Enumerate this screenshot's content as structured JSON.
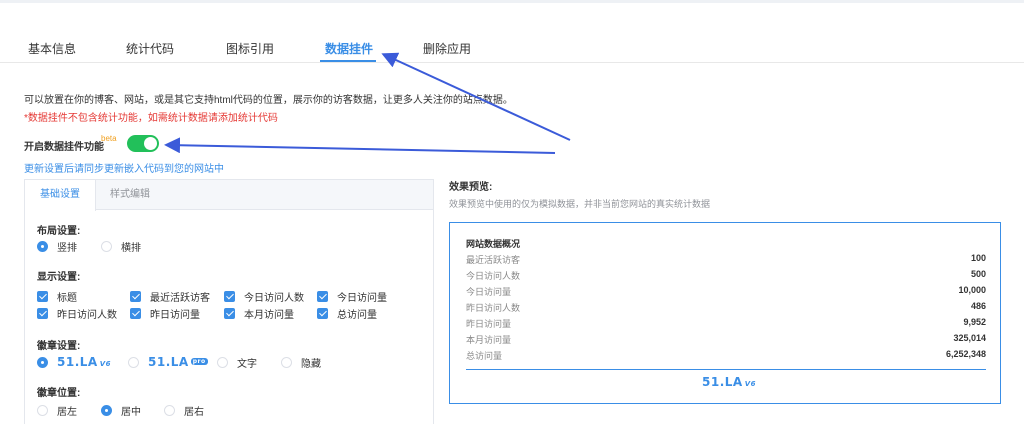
{
  "tabs": [
    {
      "label": "基本信息"
    },
    {
      "label": "统计代码"
    },
    {
      "label": "图标引用"
    },
    {
      "label": "数据挂件"
    },
    {
      "label": "删除应用"
    }
  ],
  "intro": {
    "description": "可以放置在你的博客、网站，或是其它支持html代码的位置，展示你的访客数据，让更多人关注你的站点数据。",
    "warning": "*数据挂件不包含统计功能，如需统计数据请添加统计代码"
  },
  "widget_switch": {
    "label": "开启数据挂件功能",
    "badge": "beta",
    "enabled": true
  },
  "sync_link": "更新设置后请同步更新嵌入代码到您的网站中",
  "settings": {
    "tabs": [
      {
        "label": "基础设置"
      },
      {
        "label": "样式编辑"
      }
    ],
    "layout": {
      "title": "布局设置:",
      "options": [
        {
          "label": "竖排",
          "checked": true
        },
        {
          "label": "横排",
          "checked": false
        }
      ]
    },
    "display": {
      "title": "显示设置:",
      "items": [
        {
          "label": "标题"
        },
        {
          "label": "最近活跃访客"
        },
        {
          "label": "今日访问人数"
        },
        {
          "label": "今日访问量"
        },
        {
          "label": "昨日访问人数"
        },
        {
          "label": "昨日访问量"
        },
        {
          "label": "本月访问量"
        },
        {
          "label": "总访问量"
        }
      ]
    },
    "badge": {
      "title": "徽章设置:",
      "logo_v6": {
        "brand": "51.LA",
        "suffix": "V6"
      },
      "logo_pro": {
        "brand": "51.LA",
        "suffix": "pro"
      },
      "options": [
        {
          "label": "文字"
        },
        {
          "label": "隐藏"
        }
      ]
    },
    "position": {
      "title": "徽章位置:",
      "options": [
        {
          "label": "居左",
          "checked": false
        },
        {
          "label": "居中",
          "checked": true
        },
        {
          "label": "居右",
          "checked": false
        }
      ]
    }
  },
  "preview": {
    "title": "效果预览:",
    "subtitle": "效果预览中使用的仅为模拟数据，并非当前您网站的真实统计数据",
    "widget_title": "网站数据概况",
    "stats": [
      {
        "label": "最近活跃访客",
        "value": "100"
      },
      {
        "label": "今日访问人数",
        "value": "500"
      },
      {
        "label": "今日访问量",
        "value": "10,000"
      },
      {
        "label": "昨日访问人数",
        "value": "486"
      },
      {
        "label": "昨日访问量",
        "value": "9,952"
      },
      {
        "label": "本月访问量",
        "value": "325,014"
      },
      {
        "label": "总访问量",
        "value": "6,252,348"
      }
    ],
    "logo": {
      "brand": "51.LA",
      "suffix": "V6"
    }
  },
  "colors": {
    "accent": "#3a8ee6",
    "switch_on": "#22c05a",
    "warning": "#e53935",
    "beta": "#f0a020"
  }
}
